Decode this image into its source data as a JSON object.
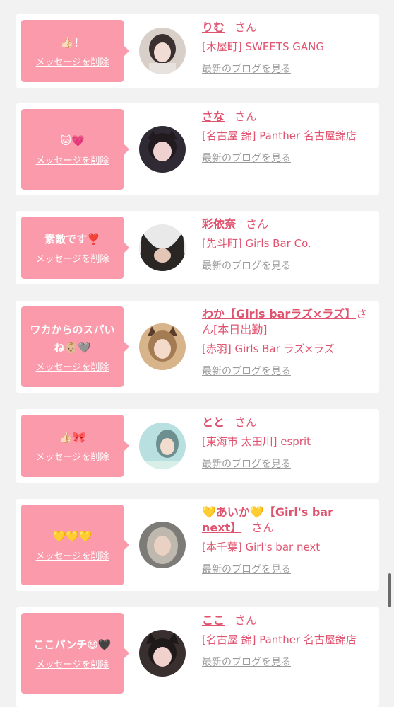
{
  "labels": {
    "delete": "メッセージを削除",
    "blog": "最新のブログを見る",
    "suffix": "さん"
  },
  "items": [
    {
      "message": "👍🏻！",
      "name": "りむ",
      "shop": "[木屋町] SWEETS GANG",
      "avatar_colors": [
        "#d8cfc8",
        "#3a3030",
        "#f1dcd3"
      ]
    },
    {
      "message": "🐱💗",
      "name": "さな",
      "shop": "[名古屋 錦] Panther 名古屋錦店",
      "avatar_colors": [
        "#2f2a33",
        "#211b20",
        "#efd2cf"
      ]
    },
    {
      "message": "素敵です❣️",
      "name": "彩依奈",
      "shop": "[先斗町] Girls Bar Co.",
      "avatar_colors": [
        "#e9e9e9",
        "#2a2624",
        "#e3c6b6"
      ]
    },
    {
      "message": "ワカからのスパいね👶🏼🩶",
      "name": "わか【Girls barラズ×ラズ】",
      "name_only": true,
      "shop": "[本日出勤]",
      "shop2": "[赤羽] Girls Bar ラズ×ラズ",
      "avatar_colors": [
        "#d7b48a",
        "#a47c53",
        "#f3dacb"
      ]
    },
    {
      "message": "👍🏻🎀",
      "name": "とと",
      "shop": "[東海市 太田川] esprit",
      "avatar_colors": [
        "#b8e0e0",
        "#6e8f8f",
        "#f2dccd"
      ]
    },
    {
      "message": "💛💛💛",
      "name": "💛あいか💛【Girl's bar next】",
      "shop": "[本千葉] Girl's bar next",
      "avatar_colors": [
        "#7d7b78",
        "#bfb8ae",
        "#e9d2c4"
      ]
    },
    {
      "message": "ここパンチ😆🖤",
      "name": "ここ",
      "shop": "[名古屋 錦] Panther 名古屋錦店",
      "avatar_colors": [
        "#3a2f2f",
        "#1f1a1a",
        "#f0d1cc"
      ]
    }
  ]
}
